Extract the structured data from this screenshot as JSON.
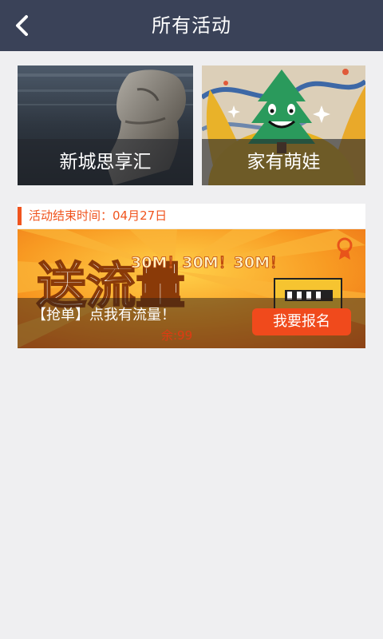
{
  "header": {
    "title": "所有活动",
    "back_icon": "chevron-left-icon"
  },
  "categories": [
    {
      "label": "新城思享汇"
    },
    {
      "label": "家有萌娃"
    }
  ],
  "activity": {
    "end_time": "活动结束时间：04月27日",
    "banner_text": {
      "big": "送流量",
      "promo": "30M！30M！30M！"
    },
    "title": "【抢单】点我有流量！",
    "remaining": "余:99",
    "signup_label": "我要报名"
  },
  "colors": {
    "header_bg": "#3a4258",
    "accent": "#f0541e",
    "page_bg": "#efeff1"
  }
}
